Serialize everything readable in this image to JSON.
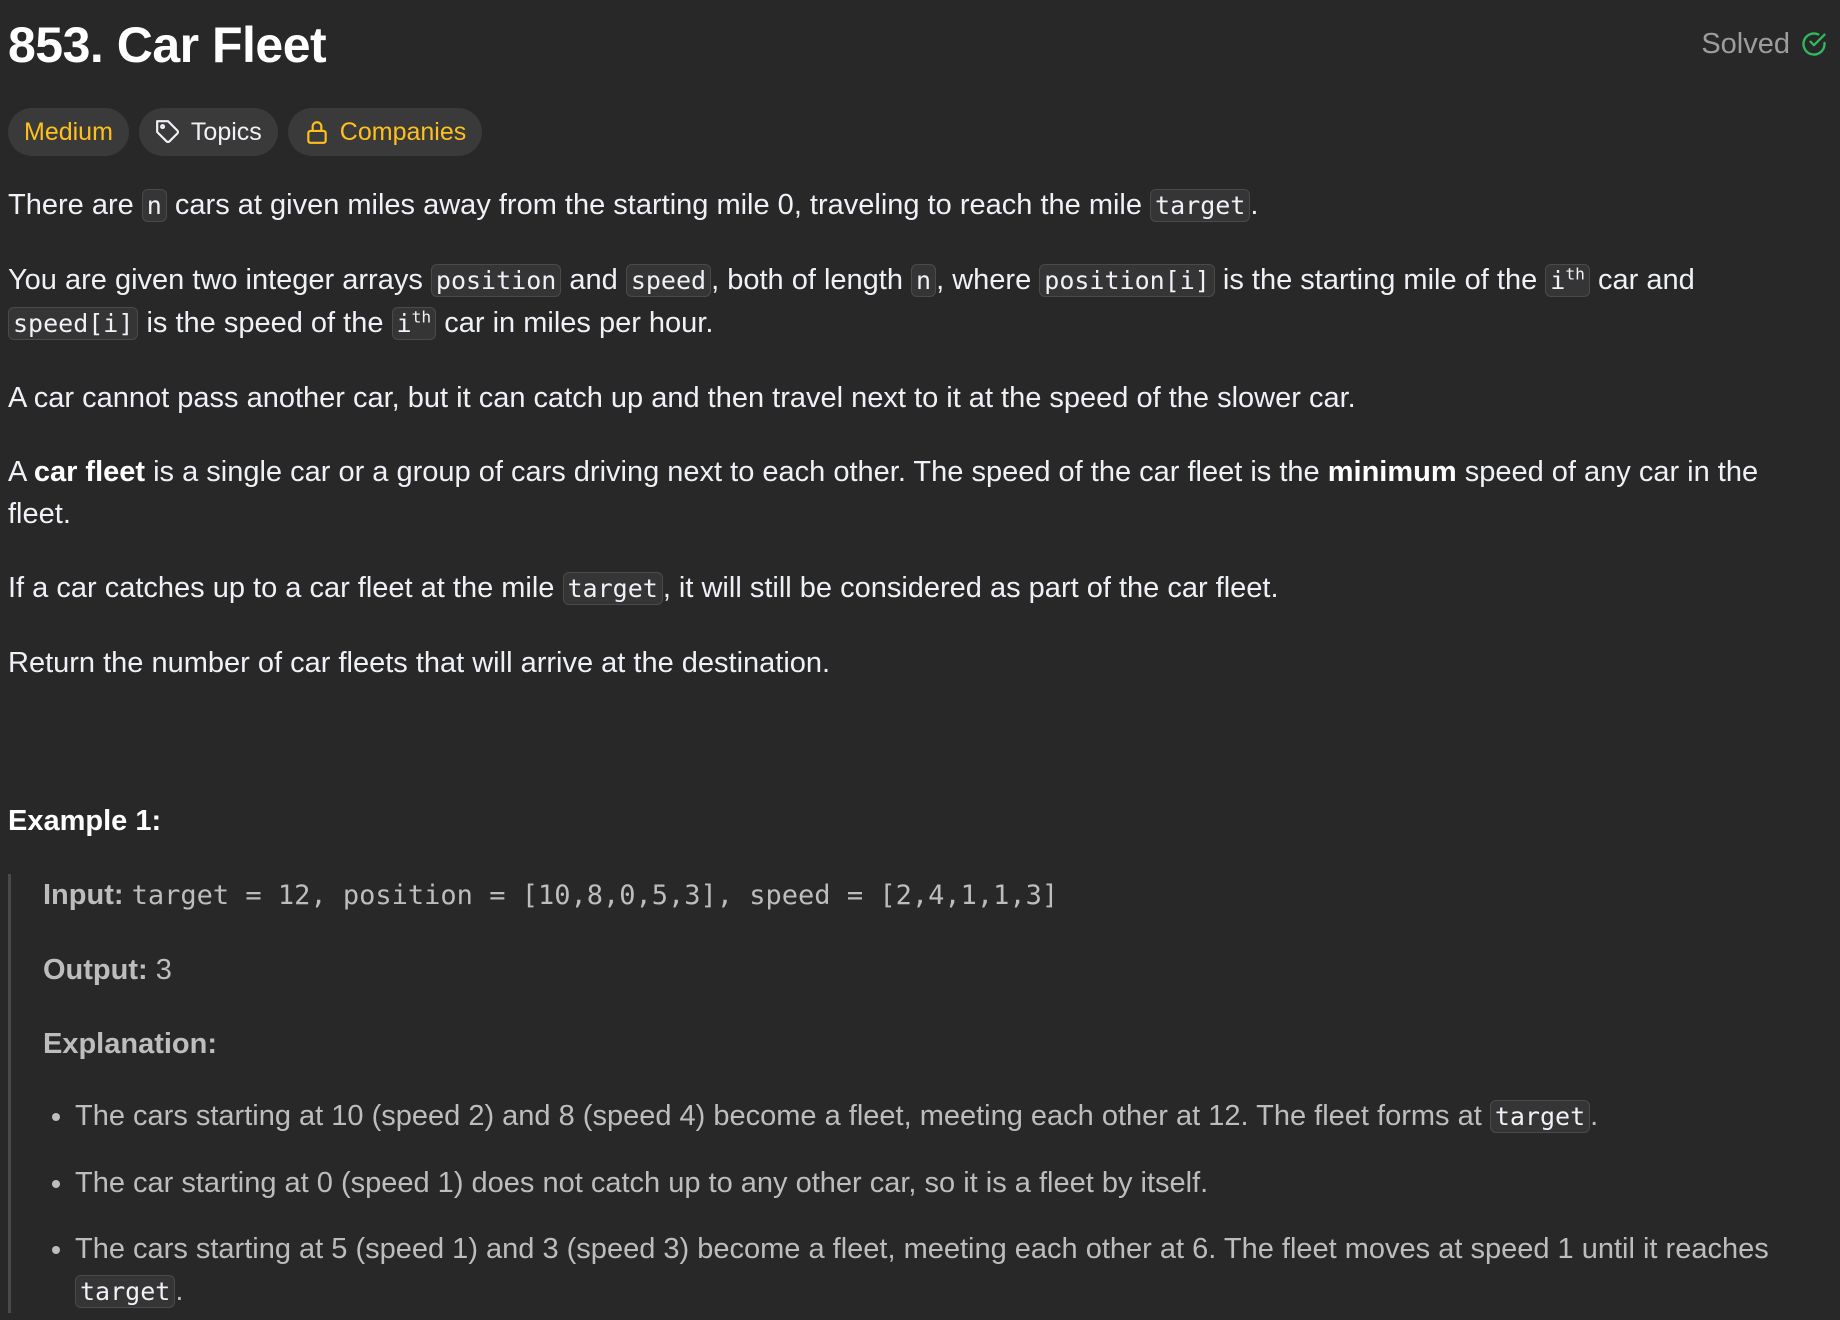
{
  "problem": {
    "title": "853. Car Fleet",
    "status": "Solved"
  },
  "tags": {
    "difficulty": "Medium",
    "topics": "Topics",
    "companies": "Companies"
  },
  "description": {
    "p1": {
      "t1": "There are ",
      "c1": "n",
      "t2": " cars at given miles away from the starting mile 0, traveling to reach the mile ",
      "c2": "target",
      "t3": "."
    },
    "p2": {
      "t1": "You are given two integer arrays ",
      "c1": "position",
      "t2": " and ",
      "c2": "speed",
      "t3": ", both of length ",
      "c3": "n",
      "t4": ", where ",
      "c4": "position[i]",
      "t5": " is the starting mile of the ",
      "c5_base": "i",
      "c5_sup": "th",
      "t6": " car and ",
      "c6": "speed[i]",
      "t7": " is the speed of the ",
      "c7_base": "i",
      "c7_sup": "th",
      "t8": " car in miles per hour."
    },
    "p3": "A car cannot pass another car, but it can catch up and then travel next to it at the speed of the slower car.",
    "p4": {
      "t1": "A ",
      "b1": "car fleet",
      "t2": " is a single car or a group of cars driving next to each other. The speed of the car fleet is the ",
      "b2": "minimum",
      "t3": " speed of any car in the fleet."
    },
    "p5": {
      "t1": "If a car catches up to a car fleet at the mile ",
      "c1": "target",
      "t2": ", it will still be considered as part of the car fleet."
    },
    "p6": "Return the number of car fleets that will arrive at the destination."
  },
  "example1": {
    "title": "Example 1:",
    "input_label": "Input:",
    "input_value": "target = 12, position = [10,8,0,5,3], speed = [2,4,1,1,3]",
    "output_label": "Output:",
    "output_value": "3",
    "explanation_label": "Explanation:",
    "bullets": [
      {
        "text": "The cars starting at 10 (speed 2) and 8 (speed 4) become a fleet, meeting each other at 12. The fleet forms at ",
        "code": "target",
        "end": "."
      },
      {
        "text": "The car starting at 0 (speed 1) does not catch up to any other car, so it is a fleet by itself."
      },
      {
        "text": "The cars starting at 5 (speed 1) and 3 (speed 3) become a fleet, meeting each other at 6. The fleet moves at speed 1 until it reaches ",
        "code": "target",
        "end": "."
      }
    ]
  },
  "colors": {
    "background": "#282828",
    "text": "#eff1f6",
    "medium": "#ffc01e",
    "solved_check": "#2cbb5d",
    "muted": "#9d9d9d"
  }
}
